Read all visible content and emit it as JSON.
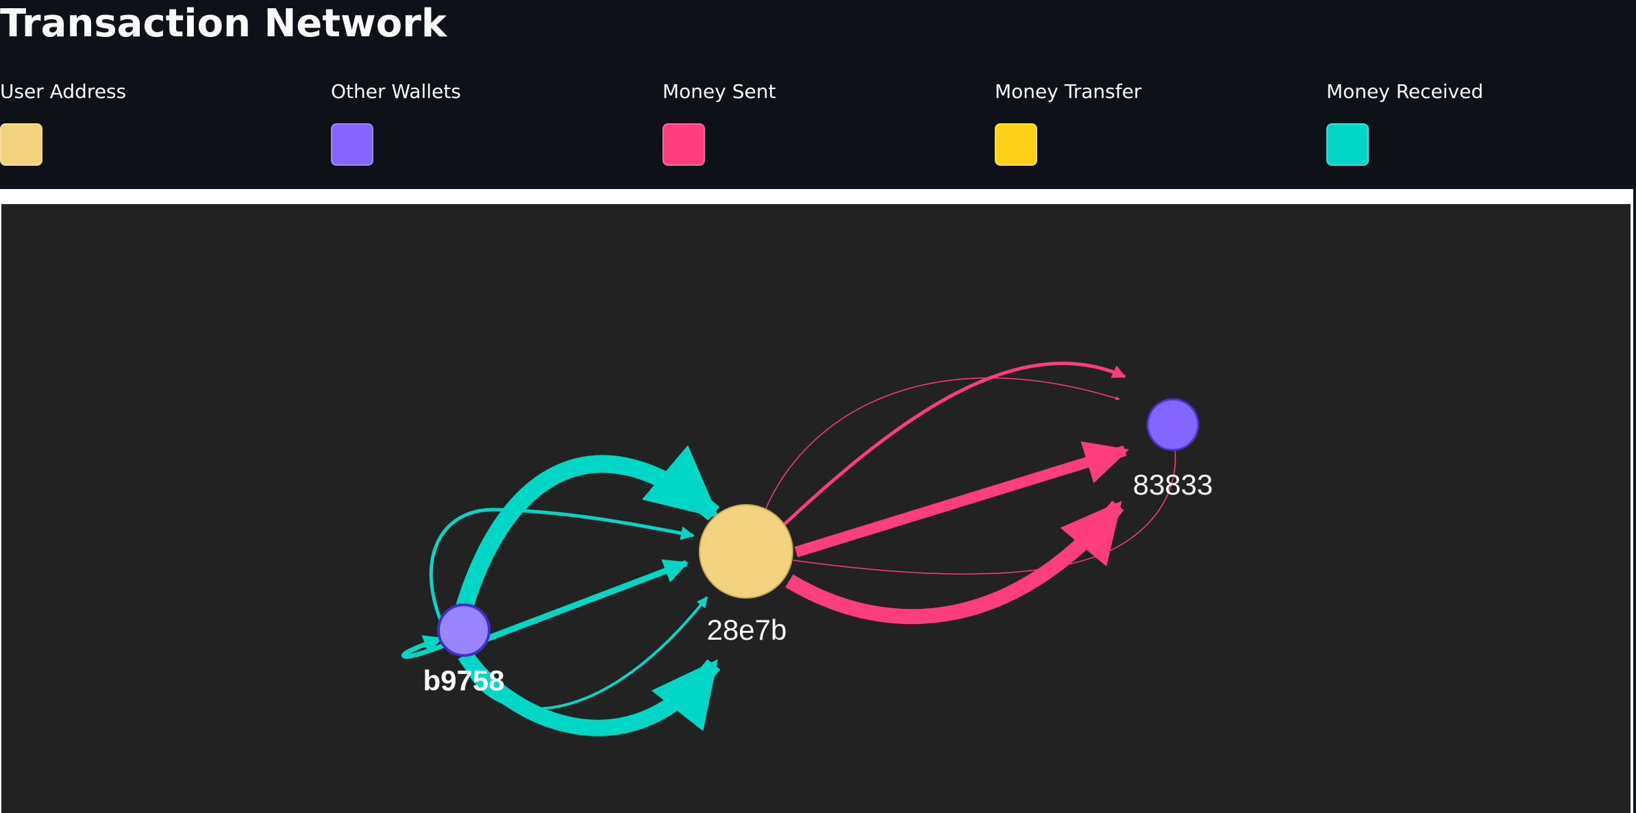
{
  "title": "Transaction Network",
  "legend": [
    {
      "label": "User Address",
      "color": "#f3d27e"
    },
    {
      "label": "Other Wallets",
      "color": "#8266ff"
    },
    {
      "label": "Money Sent",
      "color": "#ff3d7f"
    },
    {
      "label": "Money Transfer",
      "color": "#ffd21a"
    },
    {
      "label": "Money Received",
      "color": "#00d6c4"
    }
  ],
  "graph": {
    "nodes": [
      {
        "id": "28e7b",
        "label": "28e7b",
        "type": "user-address",
        "color": "#f3d27e"
      },
      {
        "id": "83833",
        "label": "83833",
        "type": "other-wallet",
        "color": "#8266ff"
      },
      {
        "id": "b9758",
        "label": "b9758",
        "type": "other-wallet",
        "color": "#9a85ff"
      }
    ],
    "edge_types": {
      "sent": "#ff3d7f",
      "received": "#00d6c4"
    }
  }
}
